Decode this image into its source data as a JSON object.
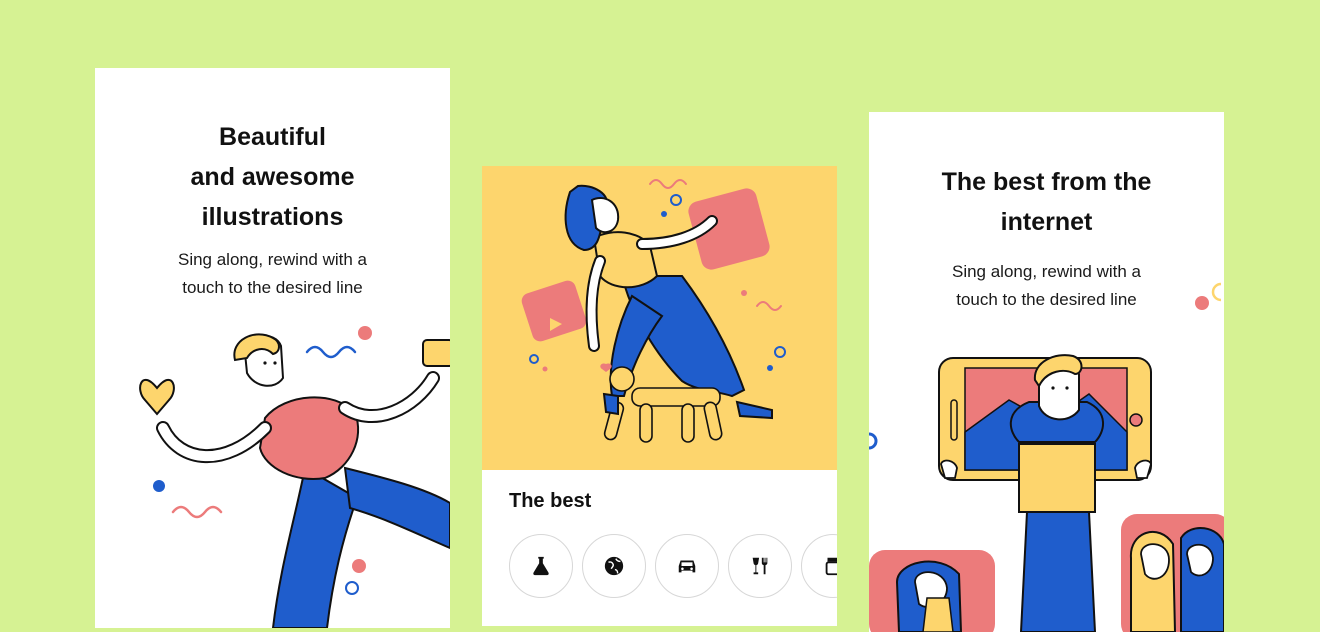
{
  "cards": {
    "left": {
      "title_lines": [
        "Beautiful",
        "and awesome",
        "illustrations"
      ],
      "subtitle_lines": [
        "Sing along, rewind with a",
        "touch to the desired line"
      ]
    },
    "middle": {
      "heading": "The best",
      "categories": [
        {
          "icon": "flask-icon"
        },
        {
          "icon": "globe-icon"
        },
        {
          "icon": "car-icon"
        },
        {
          "icon": "food-icon"
        },
        {
          "icon": "jar-icon"
        }
      ]
    },
    "right": {
      "title_lines": [
        "The best from the",
        "internet"
      ],
      "subtitle_lines": [
        "Sing along, rewind with a",
        "touch to the desired line"
      ]
    }
  },
  "colors": {
    "background": "#d6f293",
    "card": "#ffffff",
    "yellow": "#fdd56d",
    "blue": "#1f5dcc",
    "coral": "#ec7b7b",
    "dark_blue": "#10357f"
  }
}
